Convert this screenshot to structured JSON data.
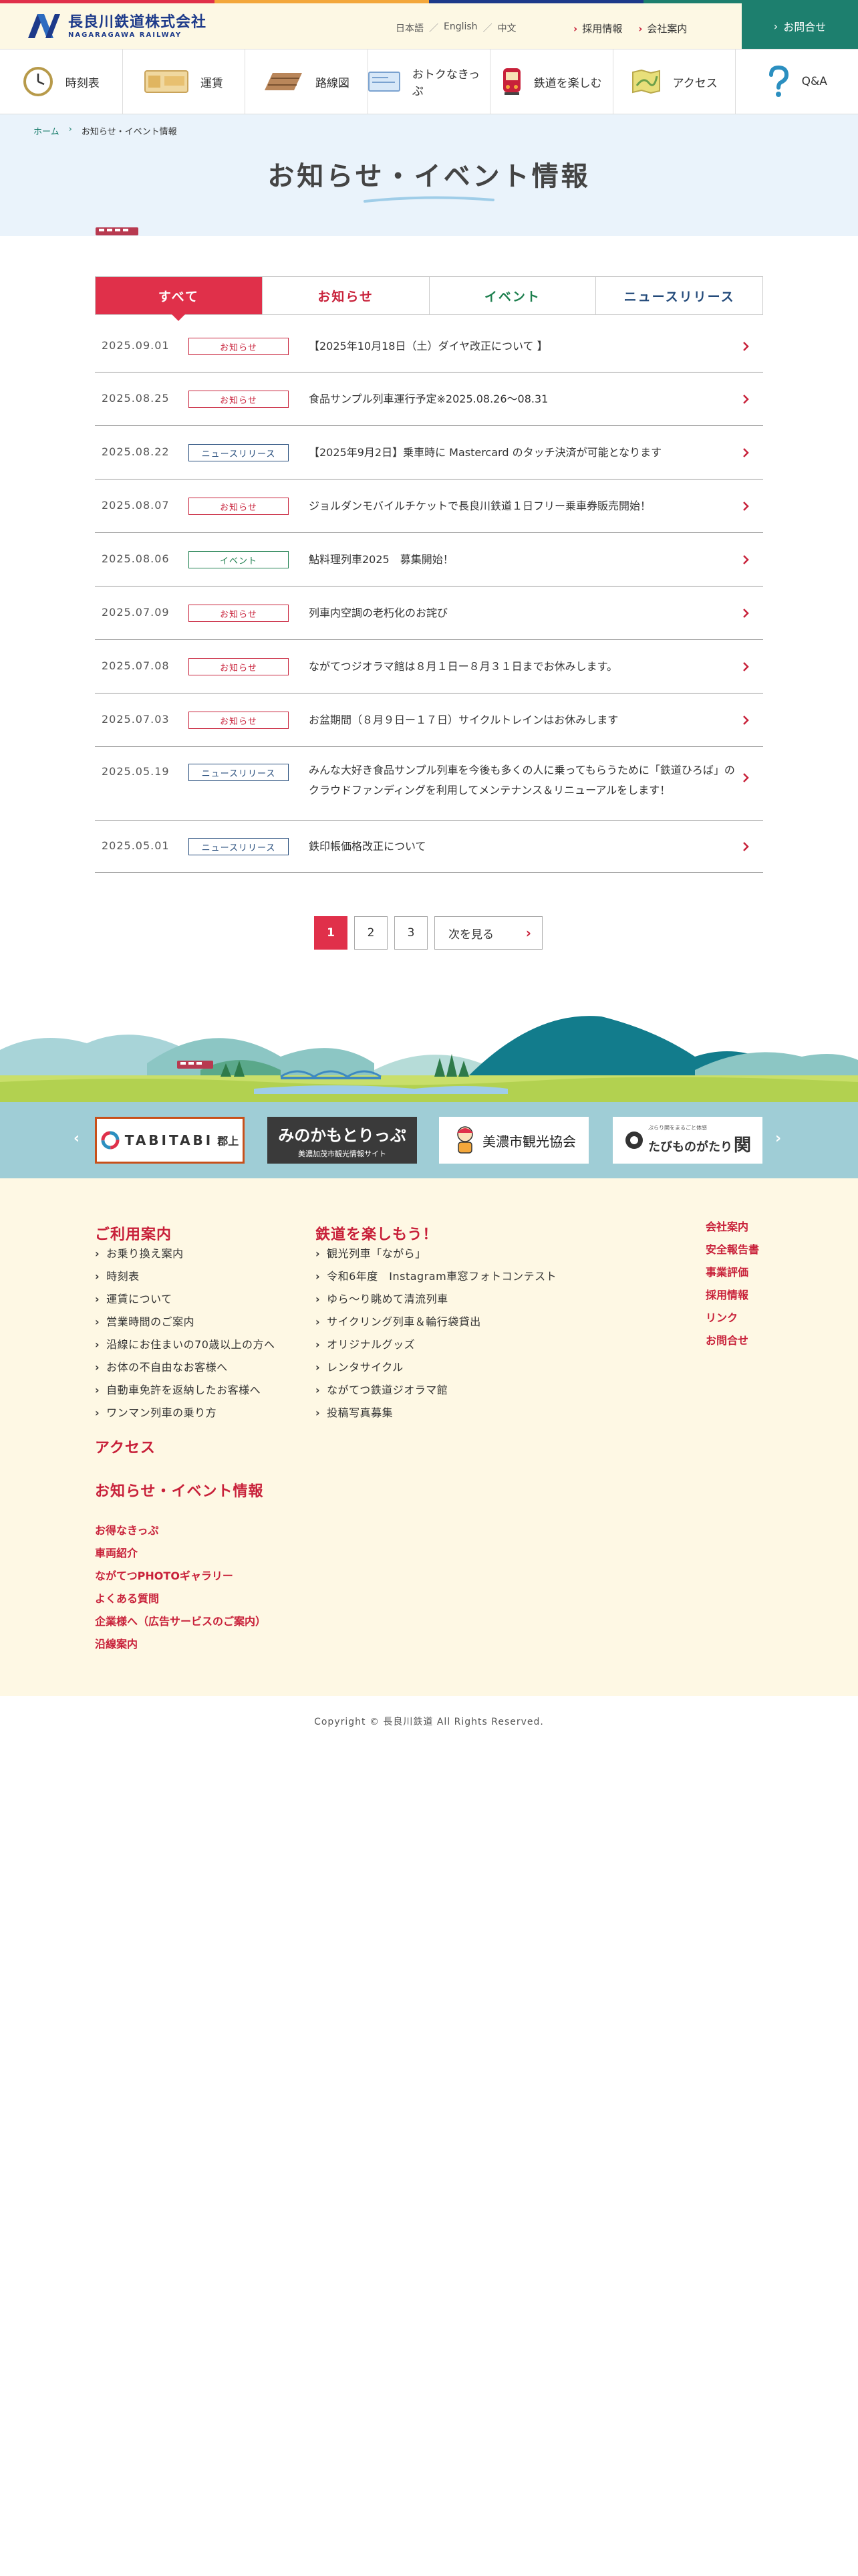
{
  "colors": {
    "accent": "#e0304a",
    "brand_blue": "#1d3a8a",
    "teal": "#1d7f6e",
    "footer_bg": "#fef8e4"
  },
  "header": {
    "logo_ja": "長良川鉄道株式会社",
    "logo_en": "NAGARAGAWA RAILWAY",
    "lang": [
      "日本語",
      "English",
      "中文"
    ],
    "lang_sep": "／",
    "links": [
      "採用情報",
      "会社案内"
    ],
    "contact": "お問合せ"
  },
  "nav": [
    {
      "label": "時刻表",
      "icon": "clock-icon"
    },
    {
      "label": "運賃",
      "icon": "ticket-icon"
    },
    {
      "label": "路線図",
      "icon": "rail-track-icon"
    },
    {
      "label": "おトクなきっぷ",
      "icon": "discount-ticket-icon"
    },
    {
      "label": "鉄道を楽しむ",
      "icon": "train-icon"
    },
    {
      "label": "アクセス",
      "icon": "map-icon"
    },
    {
      "label": "Q&A",
      "icon": "question-icon"
    }
  ],
  "breadcrumb": {
    "home": "ホーム",
    "current": "お知らせ・イベント情報"
  },
  "page_title": "お知らせ・イベント情報",
  "tabs": [
    {
      "label": "すべて",
      "active": true
    },
    {
      "label": "お知らせ"
    },
    {
      "label": "イベント"
    },
    {
      "label": "ニュースリリース"
    }
  ],
  "news": [
    {
      "date": "2025.09.01",
      "badge": "お知らせ",
      "title": "【2025年10月18日（土）ダイヤ改正について 】"
    },
    {
      "date": "2025.08.25",
      "badge": "お知らせ",
      "title": "食品サンプル列車運行予定※2025.08.26〜08.31"
    },
    {
      "date": "2025.08.22",
      "badge": "ニュースリリース",
      "title": "【2025年9月2日】乗車時に Mastercard のタッチ決済が可能となります"
    },
    {
      "date": "2025.08.07",
      "badge": "お知らせ",
      "title": "ジョルダンモバイルチケットで長良川鉄道１日フリー乗車券販売開始！"
    },
    {
      "date": "2025.08.06",
      "badge": "イベント",
      "title": "鮎料理列車2025　募集開始！"
    },
    {
      "date": "2025.07.09",
      "badge": "お知らせ",
      "title": "列車内空調の老朽化のお詫び"
    },
    {
      "date": "2025.07.08",
      "badge": "お知らせ",
      "title": "ながてつジオラマ館は８月１日ー８月３１日までお休みします。"
    },
    {
      "date": "2025.07.03",
      "badge": "お知らせ",
      "title": "お盆期間（８月９日ー１７日）サイクルトレインはお休みします"
    },
    {
      "date": "2025.05.19",
      "badge": "ニュースリリース",
      "title": "みんな大好き食品サンプル列車を今後も多くの人に乗ってもらうために「鉄道ひろば」のクラウドファンディングを利用してメンテナンス＆リニューアルをします！"
    },
    {
      "date": "2025.05.01",
      "badge": "ニュースリリース",
      "title": "鉄印帳価格改正について"
    }
  ],
  "pagination": {
    "pages": [
      "1",
      "2",
      "3"
    ],
    "current": 1,
    "next": "次を見る"
  },
  "banners": {
    "tabitabi": "TABITABI",
    "tabitabi_sub": "郡上",
    "mino_main": "みのかもとりっぷ",
    "mino_sub": "美濃加茂市観光情報サイト",
    "mino_city": "美濃市観光協会",
    "seki_small": "ぶらり関をまるごと体感",
    "seki_main": "たびものがたり",
    "seki_kanji": "関"
  },
  "footer": {
    "col1_head": "ご利用案内",
    "col1_items": [
      "お乗り換え案内",
      "時刻表",
      "運賃について",
      "営業時間のご案内",
      "沿線にお住まいの70歳以上の方へ",
      "お体の不自由なお客様へ",
      "自動車免許を返納したお客様へ",
      "ワンマン列車の乗り方"
    ],
    "access": "アクセス",
    "news_head": "お知らせ・イベント情報",
    "red_links": [
      "お得なきっぷ",
      "車両紹介",
      "ながてつPHOTOギャラリー",
      "よくある質問",
      "企業様へ（広告サービスのご案内）",
      "沿線案内"
    ],
    "col2_head": "鉄道を楽しもう！",
    "col2_items": [
      "観光列車「ながら」",
      "令和6年度　Instagram車窓フォトコンテスト",
      "ゆら〜り眺めて清流列車",
      "サイクリング列車＆輪行袋貸出",
      "オリジナルグッズ",
      "レンタサイクル",
      "ながてつ鉄道ジオラマ館",
      "投稿写真募集"
    ],
    "col3_items": [
      "会社案内",
      "安全報告書",
      "事業評価",
      "採用情報",
      "リンク",
      "お問合せ"
    ]
  },
  "copyright": "Copyright © 長良川鉄道 All Rights Reserved."
}
